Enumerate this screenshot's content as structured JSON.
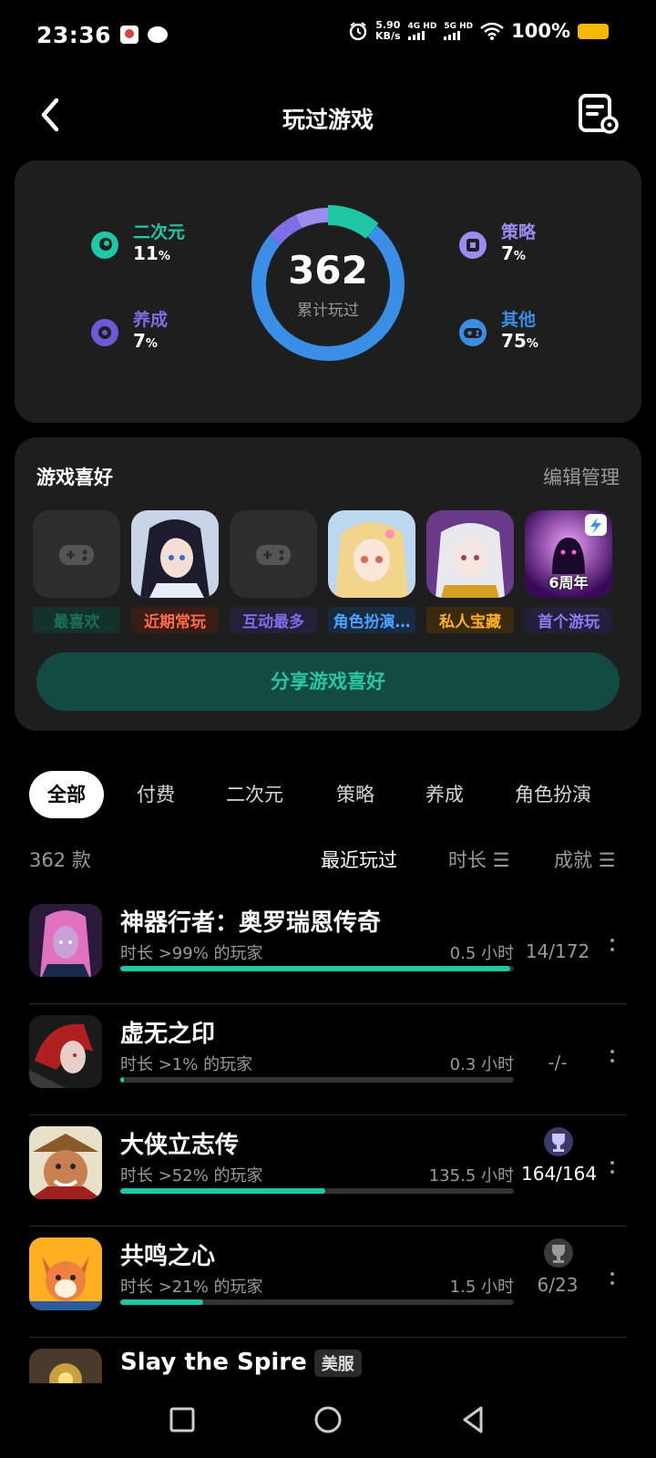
{
  "status_bar": {
    "time": "23:36",
    "speed_value": "5.90",
    "speed_unit": "KB/s",
    "net1": "4G HD",
    "net2": "5G HD",
    "battery": "100%"
  },
  "header": {
    "title": "玩过游戏"
  },
  "summary": {
    "total": "362",
    "total_label": "累计玩过",
    "categories": [
      {
        "name": "二次元",
        "pct": "11",
        "unit": "%",
        "color": "#1ec8a6",
        "icon": "anime-icon"
      },
      {
        "name": "养成",
        "pct": "7",
        "unit": "%",
        "color": "#7b6ee8",
        "icon": "raising-icon"
      },
      {
        "name": "策略",
        "pct": "7",
        "unit": "%",
        "color": "#9b8cf0",
        "icon": "strategy-icon"
      },
      {
        "name": "其他",
        "pct": "75",
        "unit": "%",
        "color": "#3a8ee6",
        "icon": "gamepad-icon"
      }
    ]
  },
  "preferences": {
    "title": "游戏喜好",
    "edit": "编辑管理",
    "items": [
      {
        "label": "最喜欢",
        "color": "#1a6e5a",
        "bg": "#13302a",
        "thumb": "gamepad-placeholder"
      },
      {
        "label": "近期常玩",
        "color": "#ff6a4a",
        "bg": "#3a1c16",
        "thumb": "anime-girl-dark"
      },
      {
        "label": "互动最多",
        "color": "#7b6ee8",
        "bg": "#23203a",
        "thumb": "gamepad-placeholder"
      },
      {
        "label": "角色扮演…",
        "color": "#4aa3ff",
        "bg": "#172a40",
        "thumb": "anime-girl-blonde"
      },
      {
        "label": "私人宝藏",
        "color": "#ffb020",
        "bg": "#3a2a10",
        "thumb": "anime-girl-white"
      },
      {
        "label": "首个游玩",
        "color": "#8b7cf5",
        "bg": "#221f3a",
        "thumb": "anniversary-6",
        "badge": "6周年"
      }
    ],
    "share_button": "分享游戏喜好"
  },
  "tabs": [
    "全部",
    "付费",
    "二次元",
    "策略",
    "养成",
    "角色扮演"
  ],
  "sort": {
    "count": "362 款",
    "recent": "最近玩过",
    "duration": "时长",
    "achievement": "成就"
  },
  "games": [
    {
      "name": "神器行者：奥罗瑞恩传奇",
      "sub": "时长 >99% 的玩家",
      "hours": "0.5 小时",
      "progress": 0.99,
      "ach": "14/172",
      "trophy": ""
    },
    {
      "name": "虚无之印",
      "sub": "时长 >1% 的玩家",
      "hours": "0.3 小时",
      "progress": 0.01,
      "ach": "-/-",
      "trophy": ""
    },
    {
      "name": "大侠立志传",
      "sub": "时长 >52% 的玩家",
      "hours": "135.5 小时",
      "progress": 0.52,
      "ach": "164/164",
      "trophy": "gold"
    },
    {
      "name": "共鸣之心",
      "sub": "时长 >21% 的玩家",
      "hours": "1.5 小时",
      "progress": 0.21,
      "ach": "6/23",
      "trophy": "silver"
    },
    {
      "name": "Slay the Spire",
      "region": "美服"
    }
  ]
}
